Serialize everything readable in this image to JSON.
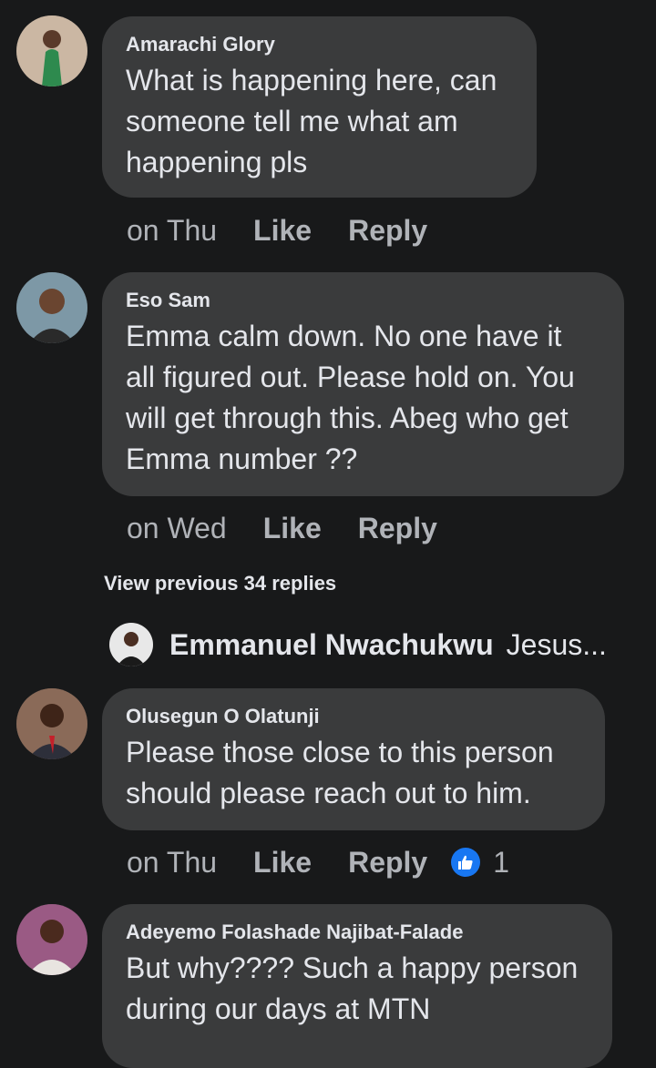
{
  "comments": [
    {
      "author": "Amarachi Glory",
      "text": "What is happening here, can\nsomeone tell me what am\nhappening pls",
      "time": "on Thu",
      "like": "Like",
      "reply": "Reply",
      "avatar_color": "#c9b39a"
    },
    {
      "author": "Eso Sam",
      "text": "Emma calm down. No one have it\nall figured out. Please hold on. You\nwill get through this. Abeg who get\nEmma number ??",
      "time": "on Wed",
      "like": "Like",
      "reply": "Reply",
      "avatar_color": "#6b8a9a"
    },
    {
      "author": "Olusegun O Olatunji",
      "text": "Please those close to this person\nshould please reach out to him.",
      "time": "on Thu",
      "like": "Like",
      "reply": "Reply",
      "reaction_count": "1",
      "reaction_icon": "thumbs-up-icon",
      "avatar_color": "#7a5a4a"
    },
    {
      "author": "Adeyemo Folashade Najibat-Falade",
      "text": "But why???? Such a happy person\nduring our days at MTN",
      "avatar_color": "#a66a8e"
    }
  ],
  "view_previous": "View previous 34 replies",
  "reply_preview": {
    "author": "Emmanuel Nwachukwu",
    "text": "Jesus..."
  },
  "colors": {
    "background": "#18191a",
    "bubble": "#3a3b3c",
    "secondary_text": "#b0b3b8",
    "like_blue": "#1877f2"
  }
}
